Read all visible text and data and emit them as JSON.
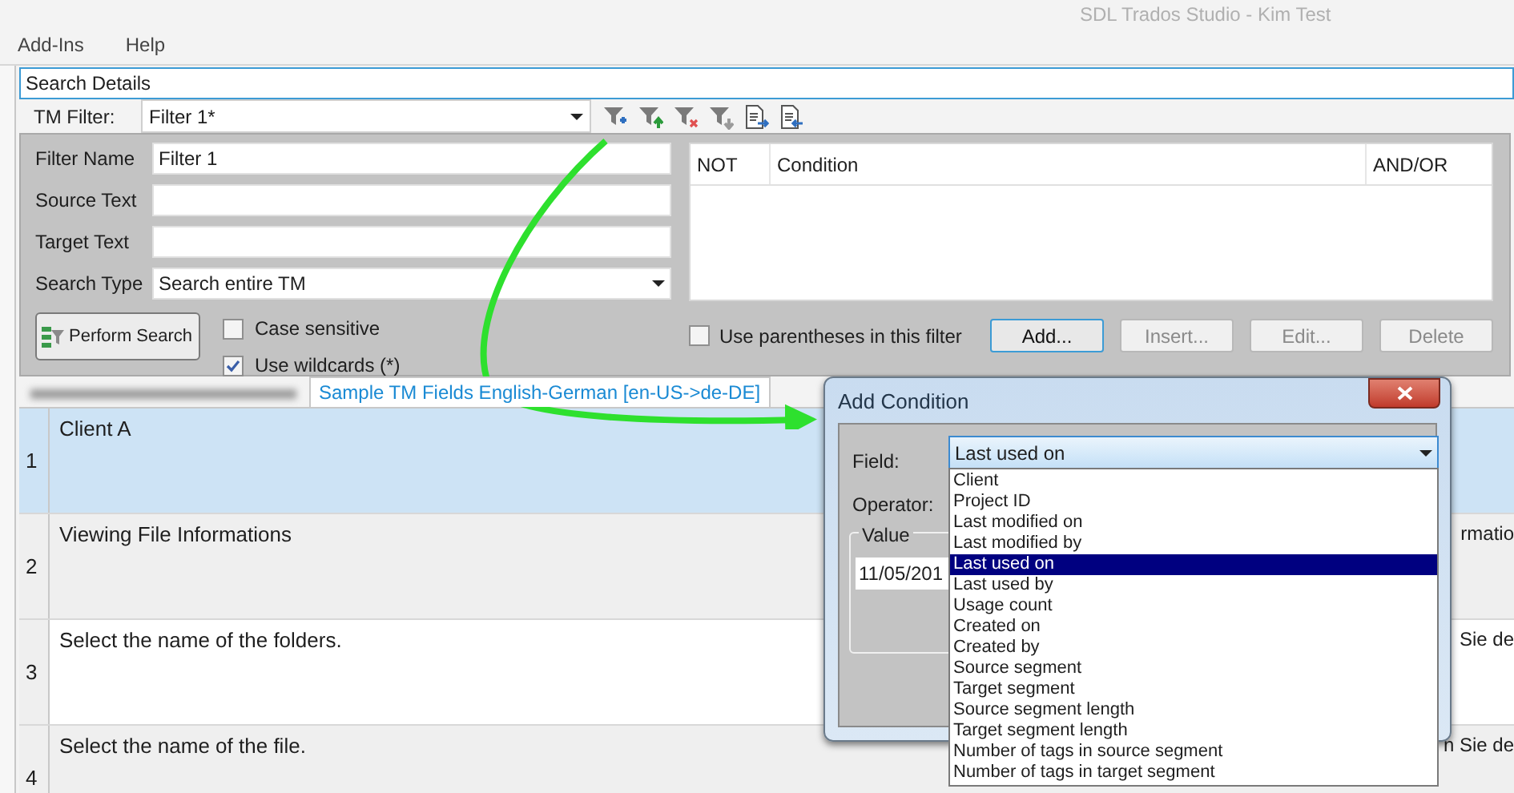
{
  "window": {
    "title": "SDL Trados Studio - Kim Test"
  },
  "menu": [
    {
      "label": "Add-Ins"
    },
    {
      "label": "Help"
    }
  ],
  "search_details": {
    "title": "Search Details",
    "tm_filter": {
      "label": "TM Filter:",
      "value": "Filter 1*"
    },
    "form": [
      {
        "label": "Filter Name",
        "value": "Filter 1",
        "kind": "text"
      },
      {
        "label": "Source Text",
        "kind": "text"
      },
      {
        "label": "Target Text",
        "kind": "text"
      },
      {
        "label": "Search Type",
        "value": "Search entire TM",
        "kind": "dropdown"
      }
    ],
    "perform_search": "Perform Search",
    "options": [
      {
        "label": "Case sensitive",
        "checked": false
      },
      {
        "label": "Use wildcards (*)",
        "checked": true
      }
    ],
    "conditions_table": {
      "columns": [
        "NOT",
        "Condition",
        "AND/OR"
      ]
    },
    "use_parentheses": {
      "label": "Use parentheses in this filter",
      "checked": false
    },
    "buttons": [
      {
        "label": "Add...",
        "disabled": false
      },
      {
        "label": "Insert...",
        "disabled": true
      },
      {
        "label": "Edit...",
        "disabled": true
      },
      {
        "label": "Delete",
        "disabled": true
      }
    ]
  },
  "document_tabs": [
    {
      "kind": "blurred",
      "selected": false
    },
    {
      "kind": "text",
      "label": "Sample TM Fields English-German [en-US->de-DE]",
      "selected": true
    }
  ],
  "segments": [
    {
      "number": "1",
      "source": "Client A",
      "selected": true
    },
    {
      "number": "2",
      "source": "Viewing File Informations",
      "target": "rmatio",
      "selected": false
    },
    {
      "number": "3",
      "source": "Select the name of the folders.",
      "target": "Sie de",
      "selected": false
    },
    {
      "number": "4",
      "source": "Select the name of the file.",
      "target": "n Sie de",
      "selected": false
    }
  ],
  "dialog": {
    "title": "Add Condition",
    "field": {
      "label": "Field:",
      "value": "Last used on",
      "options": [
        {
          "label": "Client",
          "selected": false
        },
        {
          "label": "Project ID",
          "selected": false
        },
        {
          "label": "Last modified on",
          "selected": false
        },
        {
          "label": "Last modified by",
          "selected": false
        },
        {
          "label": "Last used on",
          "selected": true
        },
        {
          "label": "Last used by",
          "selected": false
        },
        {
          "label": "Usage count",
          "selected": false
        },
        {
          "label": "Created on",
          "selected": false
        },
        {
          "label": "Created by",
          "selected": false
        },
        {
          "label": "Source segment",
          "selected": false
        },
        {
          "label": "Target segment",
          "selected": false
        },
        {
          "label": "Source segment length",
          "selected": false
        },
        {
          "label": "Target segment length",
          "selected": false
        },
        {
          "label": "Number of tags in source segment",
          "selected": false
        },
        {
          "label": "Number of tags in target segment",
          "selected": false
        }
      ]
    },
    "operator": {
      "label": "Operator:"
    },
    "value_group": {
      "label": "Value",
      "value": "11/05/201"
    }
  }
}
